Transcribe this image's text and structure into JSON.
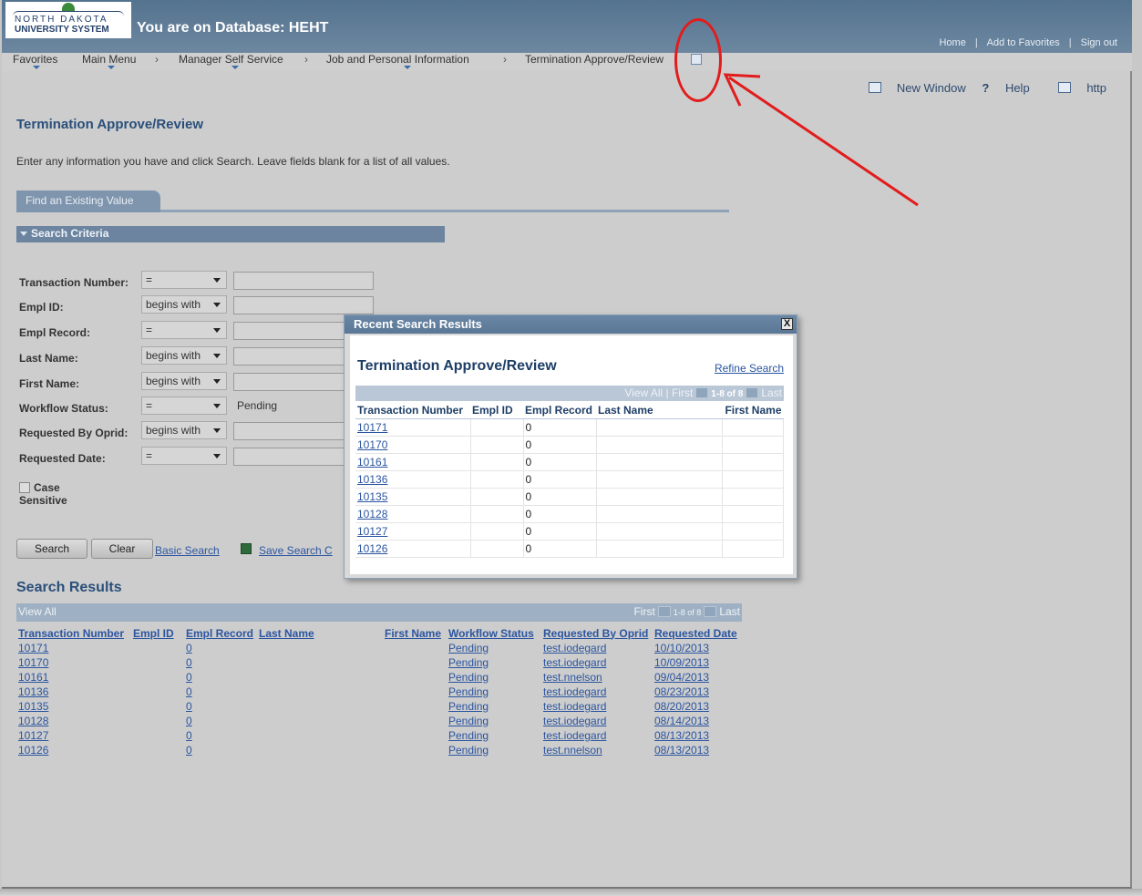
{
  "header": {
    "logo_line1": "NORTH DAKOTA",
    "logo_line2": "UNIVERSITY SYSTEM",
    "db_title": "You are on Database: HEHT",
    "links": [
      "Home",
      "Add to Favorites",
      "Sign out"
    ]
  },
  "nav": {
    "items": [
      "Favorites",
      "Main Menu",
      "Manager Self Service",
      "Job and Personal Information",
      "Termination Approve/Review"
    ]
  },
  "utilities": {
    "new_window": "New Window",
    "help": "Help",
    "http": "http"
  },
  "page": {
    "title": "Termination Approve/Review",
    "instructions": "Enter any information you have and click Search. Leave fields blank for a list of all values.",
    "tab_label": "Find an Existing Value",
    "criteria_header": "Search Criteria"
  },
  "form": {
    "fields": [
      {
        "label": "Transaction Number:",
        "op": "=",
        "value": ""
      },
      {
        "label": "Empl ID:",
        "op": "begins with",
        "value": ""
      },
      {
        "label": "Empl Record:",
        "op": "=",
        "value": ""
      },
      {
        "label": "Last Name:",
        "op": "begins with",
        "value": ""
      },
      {
        "label": "First Name:",
        "op": "begins with",
        "value": ""
      },
      {
        "label": "Workflow Status:",
        "op": "=",
        "value": "Pending"
      },
      {
        "label": "Requested By Oprid:",
        "op": "begins with",
        "value": ""
      },
      {
        "label": "Requested Date:",
        "op": "=",
        "value": ""
      }
    ],
    "case_sensitive": "Case Sensitive",
    "search_button": "Search",
    "clear_button": "Clear",
    "basic_search": "Basic Search",
    "save_search": "Save Search C"
  },
  "results": {
    "title": "Search Results",
    "view_all": "View All",
    "nav_first": "First",
    "nav_count": "1-8 of 8",
    "nav_last": "Last",
    "columns": [
      "Transaction Number",
      "Empl ID",
      "Empl Record",
      "Last Name",
      "First Name",
      "Workflow Status",
      "Requested By Oprid",
      "Requested Date"
    ],
    "rows": [
      {
        "txn": "10171",
        "rec": "0",
        "status": "Pending",
        "oprid": "test.iodegard",
        "date": "10/10/2013"
      },
      {
        "txn": "10170",
        "rec": "0",
        "status": "Pending",
        "oprid": "test.iodegard",
        "date": "10/09/2013"
      },
      {
        "txn": "10161",
        "rec": "0",
        "status": "Pending",
        "oprid": "test.nnelson",
        "date": "09/04/2013"
      },
      {
        "txn": "10136",
        "rec": "0",
        "status": "Pending",
        "oprid": "test.iodegard",
        "date": "08/23/2013"
      },
      {
        "txn": "10135",
        "rec": "0",
        "status": "Pending",
        "oprid": "test.iodegard",
        "date": "08/20/2013"
      },
      {
        "txn": "10128",
        "rec": "0",
        "status": "Pending",
        "oprid": "test.iodegard",
        "date": "08/14/2013"
      },
      {
        "txn": "10127",
        "rec": "0",
        "status": "Pending",
        "oprid": "test.iodegard",
        "date": "08/13/2013"
      },
      {
        "txn": "10126",
        "rec": "0",
        "status": "Pending",
        "oprid": "test.nnelson",
        "date": "08/13/2013"
      }
    ]
  },
  "modal": {
    "header": "Recent Search Results",
    "close": "X",
    "title": "Termination Approve/Review",
    "refine": "Refine Search",
    "view_all": "View All",
    "nav_first": "First",
    "nav_count": "1-8 of 8",
    "nav_last": "Last",
    "columns": [
      "Transaction Number",
      "Empl ID",
      "Empl Record",
      "Last Name",
      "First Name"
    ],
    "rows": [
      {
        "txn": "10171",
        "rec": "0"
      },
      {
        "txn": "10170",
        "rec": "0"
      },
      {
        "txn": "10161",
        "rec": "0"
      },
      {
        "txn": "10136",
        "rec": "0"
      },
      {
        "txn": "10135",
        "rec": "0"
      },
      {
        "txn": "10128",
        "rec": "0"
      },
      {
        "txn": "10127",
        "rec": "0"
      },
      {
        "txn": "10126",
        "rec": "0"
      }
    ]
  },
  "annotation": {
    "color": "#e21c1c"
  }
}
